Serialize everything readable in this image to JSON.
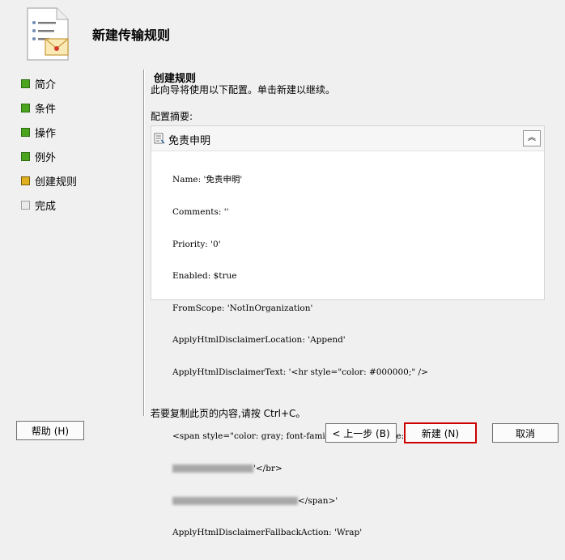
{
  "wizard": {
    "title": "新建传输规则",
    "icon": "document-envelope-icon"
  },
  "steps": [
    {
      "label": "简介",
      "status": "done"
    },
    {
      "label": "条件",
      "status": "done"
    },
    {
      "label": "操作",
      "status": "done"
    },
    {
      "label": "例外",
      "status": "done"
    },
    {
      "label": "创建规则",
      "status": "current"
    },
    {
      "label": "完成",
      "status": "pending"
    }
  ],
  "page": {
    "title": "创建规则",
    "description": "此向导将使用以下配置。单击新建以继续。",
    "summary_label": "配置摘要:"
  },
  "summary": {
    "name": "免责申明",
    "lines": [
      "Name: '免责申明'",
      "Comments: ''",
      "Priority: '0'",
      "Enabled: $true",
      "FromScope: 'NotInOrganization'",
      "ApplyHtmlDisclaimerLocation: 'Append'",
      "ApplyHtmlDisclaimerText: '<hr style=\"color: #000000;\" />",
      "",
      "<span style=\"color: gray; font-family: Arial; font-size: xx-small;\">"
    ],
    "redacted_line_1_suffix": "'</br>",
    "redacted_line_2_suffix": "</span>'",
    "last_line": "ApplyHtmlDisclaimerFallbackAction: 'Wrap'"
  },
  "footer": {
    "copy_hint": "若要复制此页的内容,请按 Ctrl+C。",
    "help_label": "帮助 (H)",
    "back_label": "< 上一步 (B)",
    "next_label": "新建 (N)",
    "cancel_label": "取消"
  },
  "colors": {
    "done": "#4aa41e",
    "current": "#e0b020",
    "pending": "#eaeaea",
    "highlight": "#cc0000"
  }
}
